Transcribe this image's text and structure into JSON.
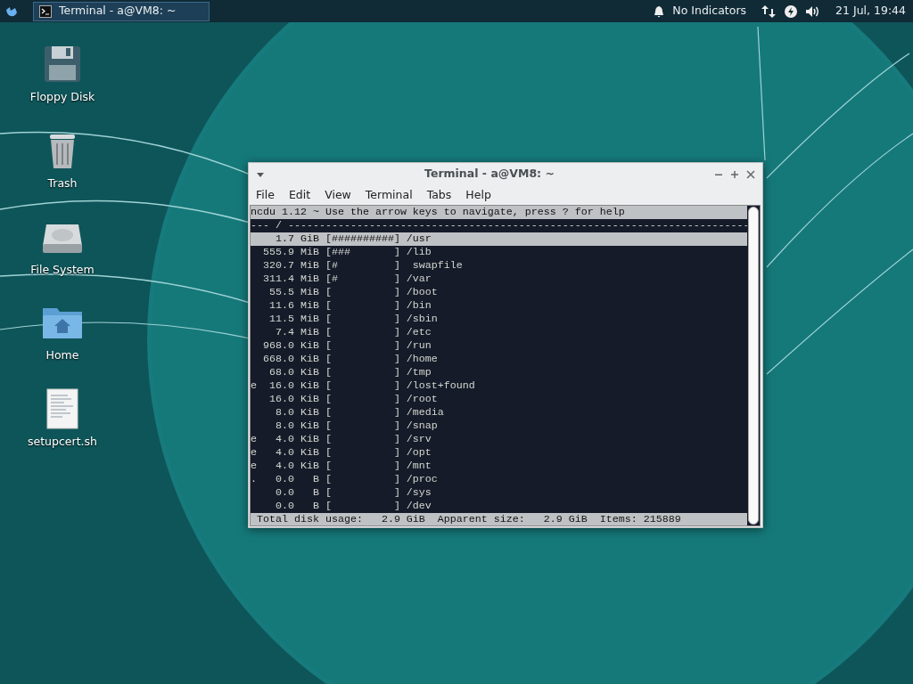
{
  "panel": {
    "task": {
      "title": "Terminal - a@VM8: ~",
      "selected": true
    },
    "indicators": "No Indicators",
    "clock": "21 Jul, 19:44"
  },
  "desktop_icons": [
    {
      "label": "Floppy Disk",
      "kind": "floppy"
    },
    {
      "label": "Trash",
      "kind": "trash"
    },
    {
      "label": "File System",
      "kind": "drive"
    },
    {
      "label": "Home",
      "kind": "home"
    },
    {
      "label": "setupcert.sh",
      "kind": "script"
    }
  ],
  "window": {
    "title": "Terminal - a@VM8: ~",
    "menu": [
      "File",
      "Edit",
      "View",
      "Terminal",
      "Tabs",
      "Help"
    ],
    "terminal": {
      "header": "ncdu 1.12 ~ Use the arrow keys to navigate, press ? for help",
      "path_line": "--- / --------------------------------------------------------------------------",
      "rows": [
        {
          "line": "    1.7 GiB [##########] /usr",
          "selected": true
        },
        {
          "line": "  555.9 MiB [###       ] /lib",
          "selected": false
        },
        {
          "line": "  320.7 MiB [#         ]  swapfile",
          "selected": false
        },
        {
          "line": "  311.4 MiB [#         ] /var",
          "selected": false
        },
        {
          "line": "   55.5 MiB [          ] /boot",
          "selected": false
        },
        {
          "line": "   11.6 MiB [          ] /bin",
          "selected": false
        },
        {
          "line": "   11.5 MiB [          ] /sbin",
          "selected": false
        },
        {
          "line": "    7.4 MiB [          ] /etc",
          "selected": false
        },
        {
          "line": "  968.0 KiB [          ] /run",
          "selected": false
        },
        {
          "line": "  668.0 KiB [          ] /home",
          "selected": false
        },
        {
          "line": "   68.0 KiB [          ] /tmp",
          "selected": false
        },
        {
          "line": "e  16.0 KiB [          ] /lost+found",
          "selected": false
        },
        {
          "line": "   16.0 KiB [          ] /root",
          "selected": false
        },
        {
          "line": "    8.0 KiB [          ] /media",
          "selected": false
        },
        {
          "line": "    8.0 KiB [          ] /snap",
          "selected": false
        },
        {
          "line": "e   4.0 KiB [          ] /srv",
          "selected": false
        },
        {
          "line": "e   4.0 KiB [          ] /opt",
          "selected": false
        },
        {
          "line": "e   4.0 KiB [          ] /mnt",
          "selected": false
        },
        {
          "line": ".   0.0   B [          ] /proc",
          "selected": false
        },
        {
          "line": "    0.0   B [          ] /sys",
          "selected": false
        },
        {
          "line": "    0.0   B [          ] /dev",
          "selected": false
        }
      ],
      "footer": " Total disk usage:   2.9 GiB  Apparent size:   2.9 GiB  Items: 215889"
    }
  }
}
